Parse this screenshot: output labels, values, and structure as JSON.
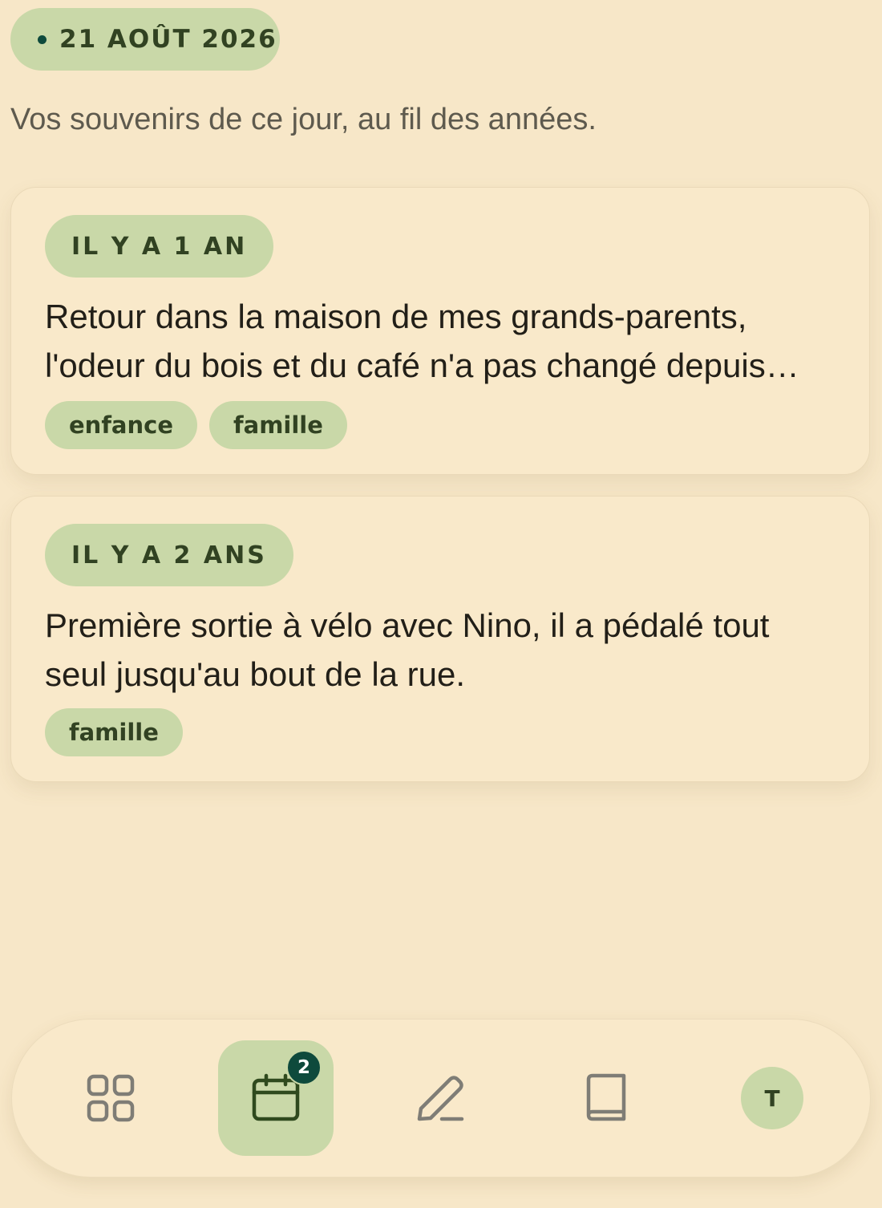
{
  "header": {
    "date_label": "21 AOÛT 2026",
    "subtitle": "Vos souvenirs de ce jour, au fil des années."
  },
  "memories": [
    {
      "age_label": "IL Y A 1 AN",
      "text": "Retour dans la maison de mes grands-parents, l'odeur du bois et du café n'a pas changé depuis…",
      "tags": [
        "enfance",
        "famille"
      ]
    },
    {
      "age_label": "IL Y A 2 ANS",
      "text": "Première sortie à vélo avec Nino, il a pédalé tout seul jusqu'au bout de la rue.",
      "tags": [
        "famille"
      ]
    }
  ],
  "nav": {
    "items": [
      {
        "icon": "grid-icon",
        "active": false
      },
      {
        "icon": "calendar-icon",
        "active": true,
        "badge": "2"
      },
      {
        "icon": "pencil-icon",
        "active": false
      },
      {
        "icon": "book-icon",
        "active": false
      },
      {
        "icon": "avatar",
        "active": false,
        "initial": "T"
      }
    ]
  },
  "colors": {
    "background": "#f7e7c8",
    "card": "#f9e9ca",
    "pill": "#c9d8a8",
    "pill_text": "#314222",
    "accent": "#0e4a3c"
  }
}
